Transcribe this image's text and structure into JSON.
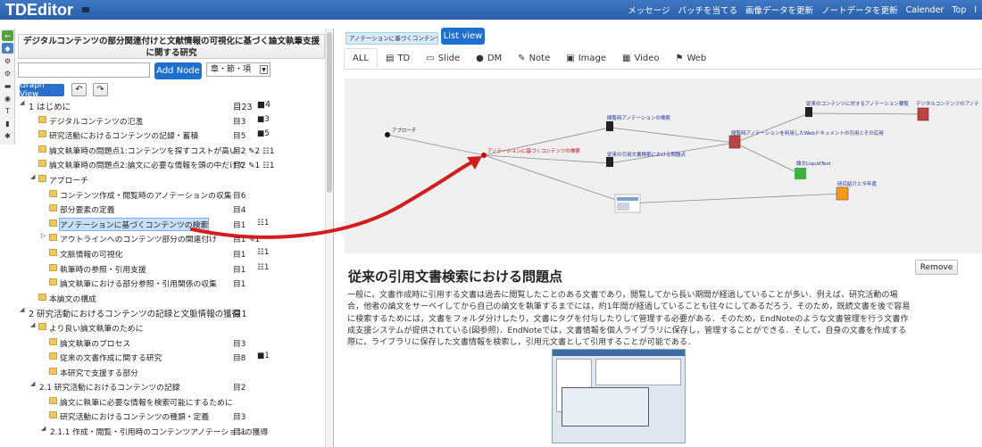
{
  "app": {
    "title": "TDEditor"
  },
  "topnav": [
    "メッセージ",
    "パッチを当てる",
    "画像データを更新",
    "ノートデータを更新",
    "Calender",
    "Top",
    "l"
  ],
  "left": {
    "doc_title": "デジタルコンテンツの部分関連付けと文献情報の可視化に基づく論文執筆支援に関する研究",
    "node_input_value": "",
    "add_node_label": "Add Node",
    "level_select_value": "章・節・項",
    "graph_view_label": "Graph View",
    "tree": [
      {
        "text": "1 はじめに",
        "c1": "目23",
        "c2": "■4",
        "indent": 0,
        "type": "toggle"
      },
      {
        "text": "デジタルコンテンツの氾濫",
        "c1": "目3",
        "c2": "■3",
        "indent": 1,
        "type": "folder"
      },
      {
        "text": "研究活動におけるコンテンツの記録・蓄積",
        "c1": "目5",
        "c2": "■5",
        "indent": 1,
        "type": "folder"
      },
      {
        "text": "論文執筆時の問題点1:コンテンツを探すコストが高い",
        "c1": "目2 ✎2 ☷1",
        "c2": "",
        "indent": 1,
        "type": "folder"
      },
      {
        "text": "論文執筆時の問題点2:論文に必要な情報を頭の中だけで",
        "c1": "目2 ✎1 ☷1",
        "c2": "",
        "indent": 1,
        "type": "folder"
      },
      {
        "text": "アプローチ",
        "c1": "",
        "c2": "",
        "indent": 1,
        "type": "toggle-folder"
      },
      {
        "text": "コンテンツ作成・閲覧時のアノテーションの収集",
        "c1": "目6",
        "c2": "",
        "indent": 2,
        "type": "folder"
      },
      {
        "text": "部分要素の定義",
        "c1": "目4",
        "c2": "",
        "indent": 2,
        "type": "folder"
      },
      {
        "text": "アノテーションに基づくコンテンツの検索",
        "c1": "目1",
        "c2": "☷1",
        "indent": 2,
        "type": "folder",
        "selected": true
      },
      {
        "text": "アウトラインへのコンテンツ部分の関連付け",
        "c1": "目1 ✎1",
        "c2": "",
        "indent": 2,
        "type": "collapsed-folder"
      },
      {
        "text": "文脈情報の可視化",
        "c1": "目1",
        "c2": "☷1",
        "indent": 2,
        "type": "folder"
      },
      {
        "text": "執筆時の参照・引用支援",
        "c1": "目1",
        "c2": "☷1",
        "indent": 2,
        "type": "folder"
      },
      {
        "text": "論文執筆における部分参照・引用関係の収集",
        "c1": "目1",
        "c2": "",
        "indent": 2,
        "type": "folder"
      },
      {
        "text": "本論文の構成",
        "c1": "",
        "c2": "",
        "indent": 1,
        "type": "folder"
      },
      {
        "text": "2 研究活動におけるコンテンツの記録と文脈情報の獲得",
        "c1": "目1",
        "c2": "",
        "indent": 0,
        "type": "toggle"
      },
      {
        "text": "より良い論文執筆のために",
        "c1": "",
        "c2": "",
        "indent": 1,
        "type": "toggle-folder"
      },
      {
        "text": "論文執筆のプロセス",
        "c1": "目3",
        "c2": "",
        "indent": 2,
        "type": "folder"
      },
      {
        "text": "従来の文書作成に関する研究",
        "c1": "目8",
        "c2": "■1",
        "indent": 2,
        "type": "folder"
      },
      {
        "text": "本研究で支援する部分",
        "c1": "",
        "c2": "",
        "indent": 2,
        "type": "folder"
      },
      {
        "text": "2.1 研究活動におけるコンテンツの記録",
        "c1": "目2",
        "c2": "",
        "indent": 1,
        "type": "toggle"
      },
      {
        "text": "論文に執筆に必要な情報を検索可能にするために",
        "c1": "",
        "c2": "",
        "indent": 2,
        "type": "folder"
      },
      {
        "text": "研究活動におけるコンテンツの種類・定義",
        "c1": "目3",
        "c2": "",
        "indent": 2,
        "type": "folder"
      },
      {
        "text": "2.1.1 作成・閲覧・引用時のコンテンツアノテーションの獲得",
        "c1": "目1",
        "c2": "",
        "indent": 2,
        "type": "toggle"
      }
    ]
  },
  "right": {
    "annotation_chip": "アノテーションに基づくコンテンツの検索",
    "list_view_label": "List view",
    "tabs": [
      {
        "label": "ALL",
        "icon": ""
      },
      {
        "label": "TD",
        "icon": "▤"
      },
      {
        "label": "Slide",
        "icon": "▭"
      },
      {
        "label": "DM",
        "icon": "●"
      },
      {
        "label": "Note",
        "icon": "✎"
      },
      {
        "label": "Image",
        "icon": "▣"
      },
      {
        "label": "Video",
        "icon": "▦"
      },
      {
        "label": "Web",
        "icon": "⚑"
      }
    ],
    "graph_labels": {
      "approach": "アプローチ",
      "search": "アノテーションに基づくコンテンツの検索",
      "browse_annot": "閲覧時アノテーションの検索",
      "prior_annot": "従来のコンテンツに対するアノテーション要覧",
      "digital_annot": "デジタルコンテンツのアノテ",
      "browse_use": "閲覧時アノテーションを利用したWebドキュメントの引用とその応用",
      "citation_problem": "従来の引用文書検索における問題点",
      "liquid": "論文LiquidText",
      "research_intro": "研究紹介と今年度"
    },
    "remove_label": "Remove",
    "content_heading": "従来の引用文書検索における問題点",
    "content_text": "一般に，文書作成時に引用する文書は過去に閲覧したことのある文書であり，閲覧してから長い期間が経過していることが多い．例えば，研究活動の場合，他者の論文をサーベイしてから自己の論文を執筆するまでには，約1年間が経過していることも往々にしてあるだろう．そのため，既読文書を後で容易に検索するためには，文書をフォルダ分けしたり，文書にタグを付与したりして管理する必要がある．そのため，EndNoteのような文書管理を行う文書作成支援システムが提供されている(図参照)．EndNoteでは，文書情報を個人ライブラリに保存し，管理することができる．そして，自身の文書を作成する際に，ライブラリに保存した文書情報を検索し，引用元文書として引用することが可能である．"
  }
}
